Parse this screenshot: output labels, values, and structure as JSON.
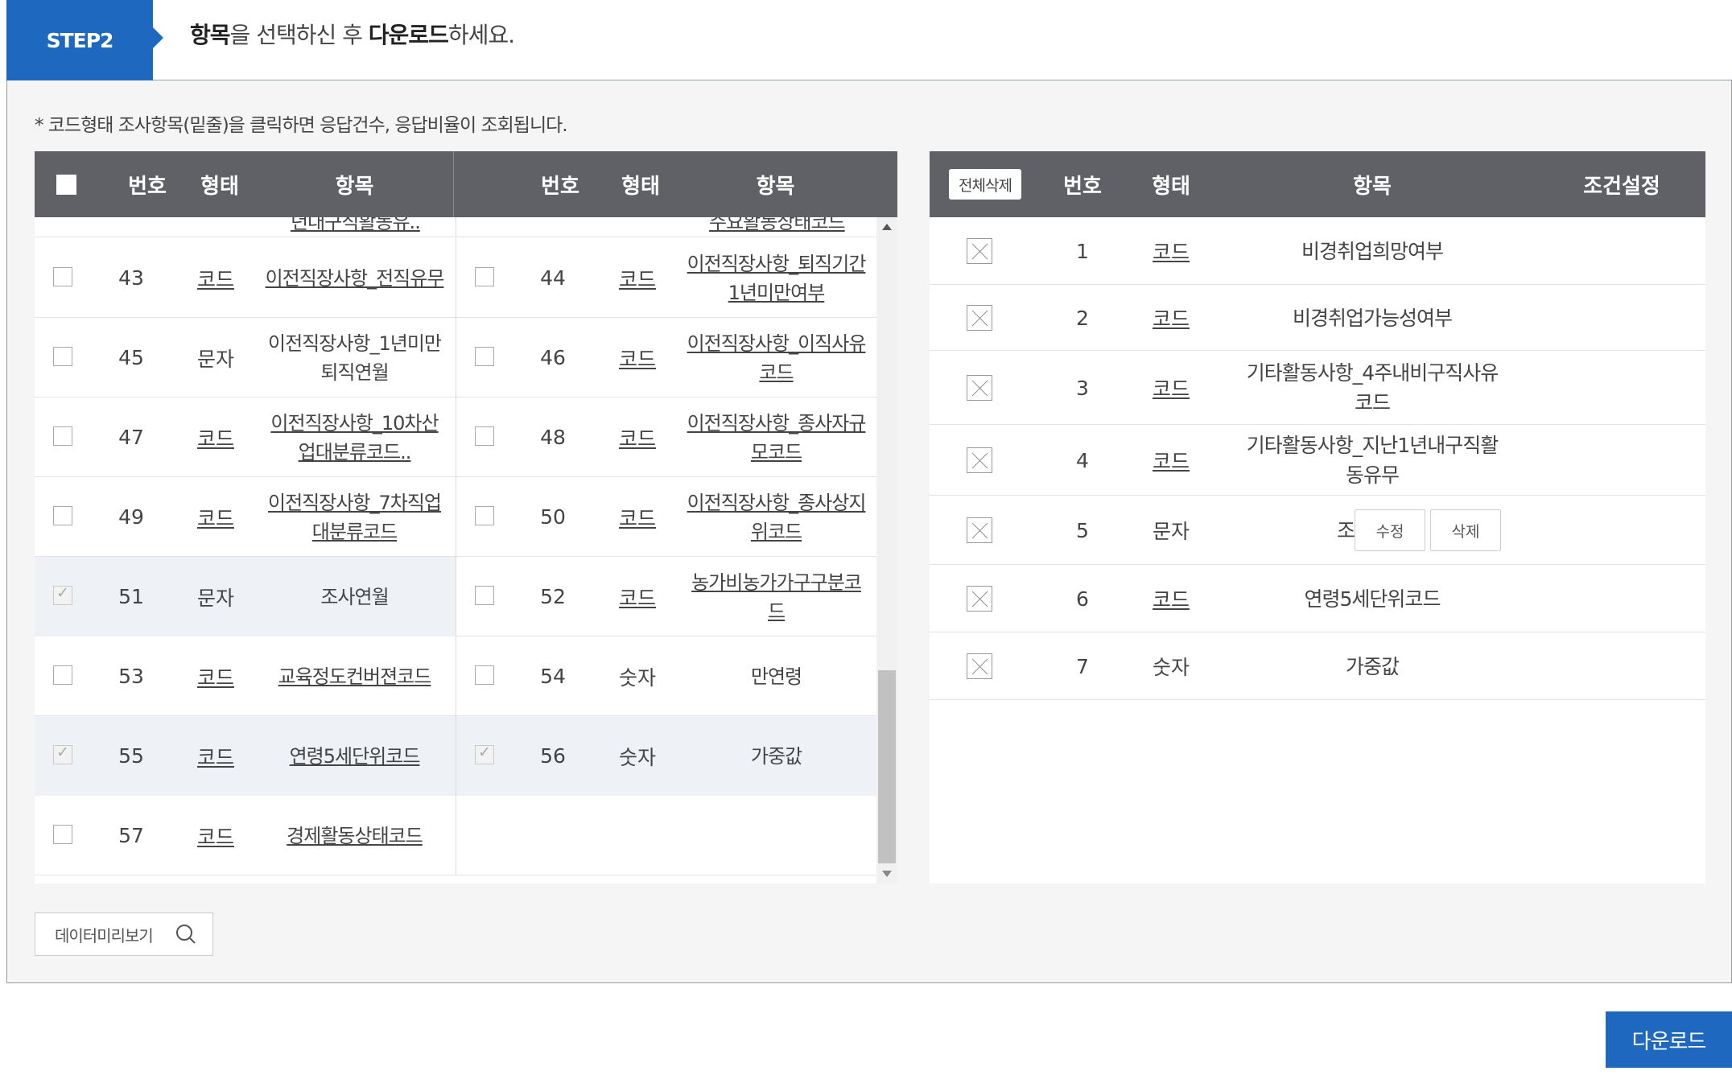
{
  "step": {
    "badge": "STEP2",
    "title_part1": "항목",
    "title_part2": "을 선택하신 후 ",
    "title_part3": "다운로드",
    "title_part4": "하세요."
  },
  "note": "* 코드형태 조사항목(밑줄)을 클릭하면 응답건수, 응답비율이 조회됩니다.",
  "left_grid": {
    "headers": [
      "번호",
      "형태",
      "항목",
      "번호",
      "형태",
      "항목"
    ],
    "partial_row": {
      "left_item": "년대구직활동유..",
      "right_item": "주요활동상태코드"
    },
    "rows": [
      {
        "left": {
          "num": "43",
          "type": "코드",
          "item": "이전직장사항_전직유무",
          "link": true,
          "checked": false
        },
        "right": {
          "num": "44",
          "type": "코드",
          "item": "이전직장사항_퇴직기간1년미만여부",
          "link": true,
          "checked": false
        }
      },
      {
        "left": {
          "num": "45",
          "type": "문자",
          "item": "이전직장사항_1년미만퇴직연월",
          "link": false,
          "checked": false
        },
        "right": {
          "num": "46",
          "type": "코드",
          "item": "이전직장사항_이직사유코드",
          "link": true,
          "checked": false
        }
      },
      {
        "left": {
          "num": "47",
          "type": "코드",
          "item": "이전직장사항_10차산업대분류코드..",
          "link": true,
          "checked": false
        },
        "right": {
          "num": "48",
          "type": "코드",
          "item": "이전직장사항_종사자규모코드",
          "link": true,
          "checked": false
        }
      },
      {
        "left": {
          "num": "49",
          "type": "코드",
          "item": "이전직장사항_7차직업대분류코드",
          "link": true,
          "checked": false
        },
        "right": {
          "num": "50",
          "type": "코드",
          "item": "이전직장사항_종사상지위코드",
          "link": true,
          "checked": false
        }
      },
      {
        "left": {
          "num": "51",
          "type": "문자",
          "item": "조사연월",
          "link": false,
          "checked": true
        },
        "right": {
          "num": "52",
          "type": "코드",
          "item": "농가비농가가구구분코드",
          "link": true,
          "checked": false
        }
      },
      {
        "left": {
          "num": "53",
          "type": "코드",
          "item": "교육정도컨버젼코드",
          "link": true,
          "checked": false
        },
        "right": {
          "num": "54",
          "type": "숫자",
          "item": "만연령",
          "link": false,
          "checked": false
        }
      },
      {
        "left": {
          "num": "55",
          "type": "코드",
          "item": "연령5세단위코드",
          "link": true,
          "checked": true
        },
        "right": {
          "num": "56",
          "type": "숫자",
          "item": "가중값",
          "link": false,
          "checked": true
        }
      },
      {
        "left": {
          "num": "57",
          "type": "코드",
          "item": "경제활동상태코드",
          "link": true,
          "checked": false
        },
        "right": null
      }
    ]
  },
  "right_grid": {
    "delete_all": "전체삭제",
    "headers": [
      "번호",
      "형태",
      "항목",
      "조건설정"
    ],
    "rows": [
      {
        "num": "1",
        "type": "코드",
        "item": "비경취업희망여부",
        "link": false
      },
      {
        "num": "2",
        "type": "코드",
        "item": "비경취업가능성여부",
        "link": false
      },
      {
        "num": "3",
        "type": "코드",
        "item_line1": "기타활동사항_4주내비구직사유",
        "item_line2": "코드",
        "link": true
      },
      {
        "num": "4",
        "type": "코드",
        "item_line1": "기타활동사항_지난1년내구직활",
        "item_line2": "동유무",
        "link": true
      },
      {
        "num": "5",
        "type": "문자",
        "item": "조사연월",
        "link": false,
        "edit": "수정",
        "delete": "삭제"
      },
      {
        "num": "6",
        "type": "코드",
        "item": "연령5세단위코드",
        "link": false
      },
      {
        "num": "7",
        "type": "숫자",
        "item": "가중값",
        "link": false
      }
    ]
  },
  "preview_button": "데이터미리보기",
  "download_button": "다운로드",
  "colors": {
    "accent": "#1e68c0",
    "header": "#5f6166",
    "panel": "#f5f5f5",
    "selected_row": "#eef1f6"
  }
}
